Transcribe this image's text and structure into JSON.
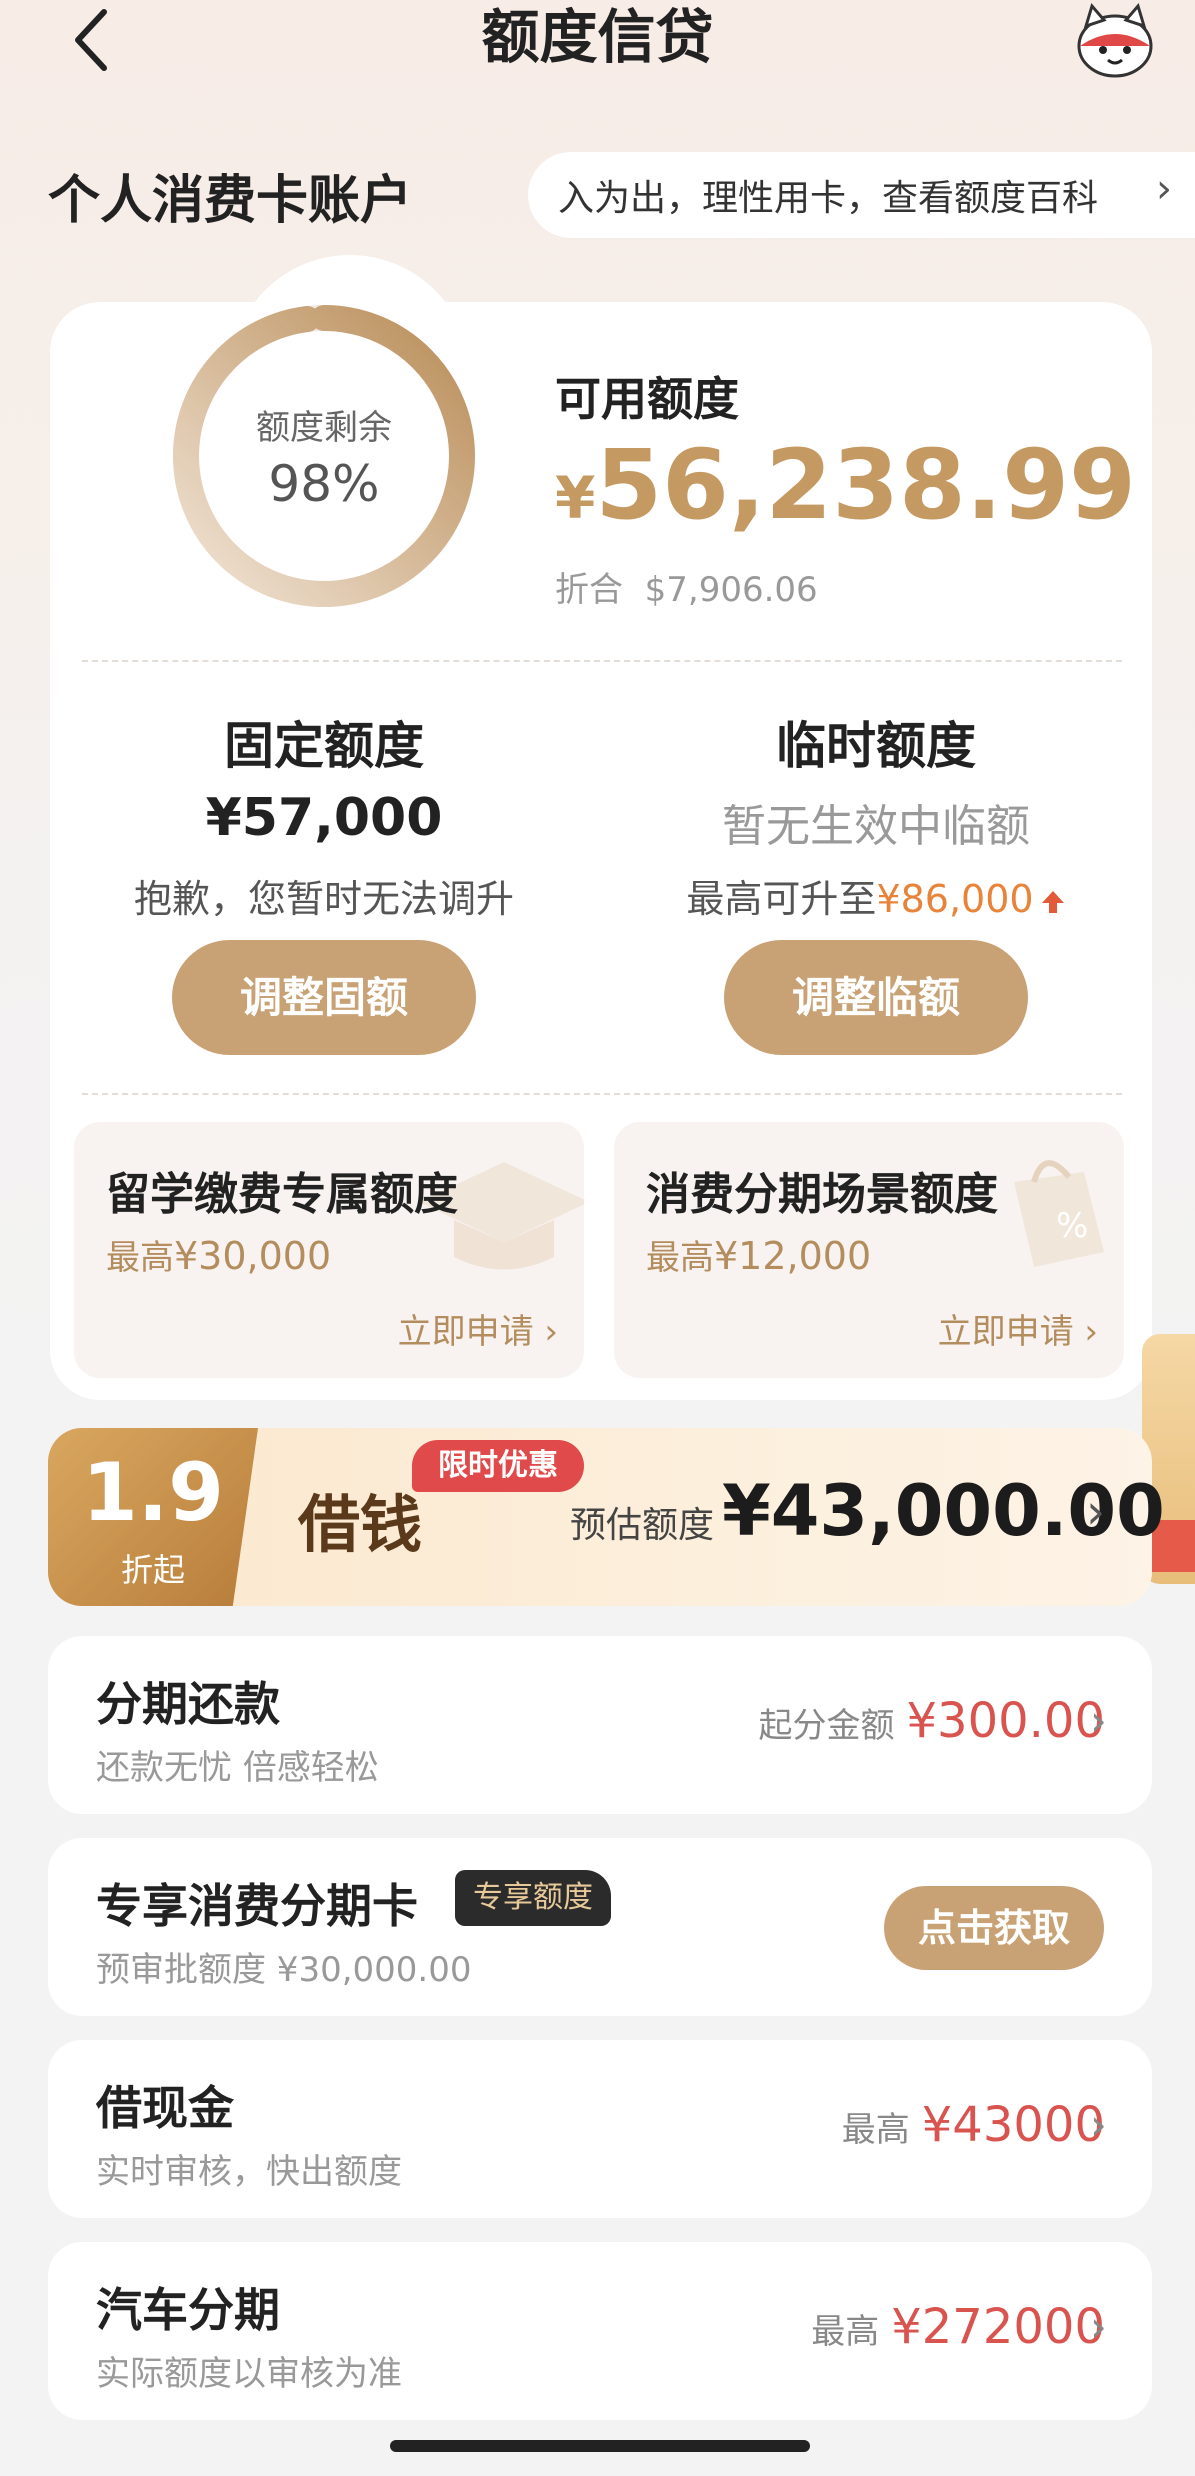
{
  "header": {
    "title": "额度信贷"
  },
  "account": {
    "title": "个人消费卡账户",
    "marquee": "入为出，理性用卡，查看额度百科"
  },
  "summary": {
    "ring_label": "额度剩余",
    "ring_value": "98%",
    "ring_fraction": 0.98,
    "available_label": "可用额度",
    "currency": "¥",
    "available_amount": "56,238.99",
    "converted_label": "折合",
    "converted_amount": "$7,906.06"
  },
  "fixed": {
    "title": "固定额度",
    "amount": "¥57,000",
    "note": "抱歉，您暂时无法调升",
    "button": "调整固额"
  },
  "temporary": {
    "title": "临时额度",
    "status": "暂无生效中临额",
    "note_prefix": "最高可升至",
    "note_amount": "¥86,000",
    "button": "调整临额"
  },
  "special_cards": [
    {
      "title": "留学缴费专属额度",
      "max_prefix": "最高",
      "max_amount": "¥30,000",
      "apply": "立即申请"
    },
    {
      "title": "消费分期场景额度",
      "max_prefix": "最高",
      "max_amount": "¥12,000",
      "apply": "立即申请"
    }
  ],
  "loan": {
    "rate": "1.9",
    "rate_sub": "折起",
    "title": "借钱",
    "promo": "限时优惠",
    "estimate_label": "预估额度",
    "estimate_amount": "¥43,000.00"
  },
  "rows": {
    "installment": {
      "title": "分期还款",
      "sub": "还款无忧 倍感轻松",
      "right_label": "起分金额",
      "right_amount": "¥300.00"
    },
    "exclusive": {
      "title": "专享消费分期卡",
      "tag": "专享额度",
      "sub": "预审批额度 ¥30,000.00",
      "button": "点击获取"
    },
    "cash": {
      "title": "借现金",
      "sub": "实时审核，快出额度",
      "right_label": "最高",
      "right_amount": "¥43000"
    },
    "car": {
      "title": "汽车分期",
      "sub": "实际额度以审核为准",
      "right_label": "最高",
      "right_amount": "¥272000"
    }
  },
  "colors": {
    "gold": "#c8a274",
    "red": "#d9534f",
    "orange": "#e8843a"
  },
  "icons": {
    "back": "chevron-left-icon",
    "mascot": "mascot-icon",
    "chevron": "chevron-right-icon"
  }
}
